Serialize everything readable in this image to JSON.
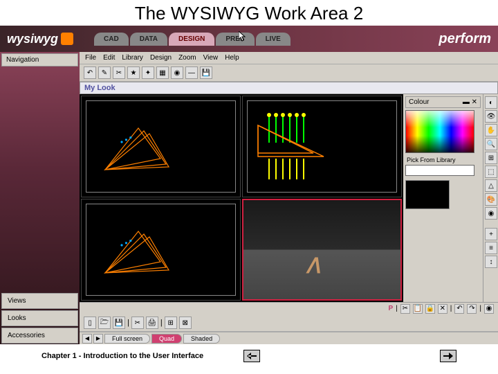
{
  "slide": {
    "title": "The WYSIWYG Work Area 2",
    "footer": "Chapter 1 - Introduction to the User Interface"
  },
  "app": {
    "logo": "wysiwyg",
    "brand": "perform",
    "mode_tabs": [
      {
        "label": "CAD",
        "active": false
      },
      {
        "label": "DATA",
        "active": false
      },
      {
        "label": "DESIGN",
        "active": true
      },
      {
        "label": "PRES",
        "active": false
      },
      {
        "label": "LIVE",
        "active": false
      }
    ]
  },
  "sidebar": {
    "header": "Navigation",
    "bottom": [
      {
        "label": "Views"
      },
      {
        "label": "Looks"
      },
      {
        "label": "Accessories"
      }
    ]
  },
  "menu": [
    "File",
    "Edit",
    "Library",
    "Design",
    "Zoom",
    "View",
    "Help"
  ],
  "look_title": "My Look",
  "right_panel": {
    "header": "Colour",
    "lib_label": "Pick From Library"
  },
  "toolbar_top_icons": [
    "↶",
    "✎",
    "✂",
    "★",
    "✦",
    "▦",
    "◉",
    "—",
    "💾"
  ],
  "toolbar_mid_icons": [
    "▯",
    "🗁",
    "💾",
    "|",
    "✂",
    "🖨",
    "|",
    "⊞",
    "⊠"
  ],
  "right_tools": [
    "◐",
    "👁",
    "✋",
    "🔍",
    "⊞",
    "⬚",
    "△",
    "🎨",
    "◉",
    "+",
    "≡",
    "↕"
  ],
  "status": {
    "p_label": "P",
    "icons": [
      "✂",
      "📋",
      "🔒",
      "✕",
      "↶",
      "↷",
      "◉"
    ]
  },
  "view_tabs": [
    {
      "label": "Full screen",
      "active": false
    },
    {
      "label": "Quad",
      "active": true
    },
    {
      "label": "Shaded",
      "active": false
    }
  ]
}
